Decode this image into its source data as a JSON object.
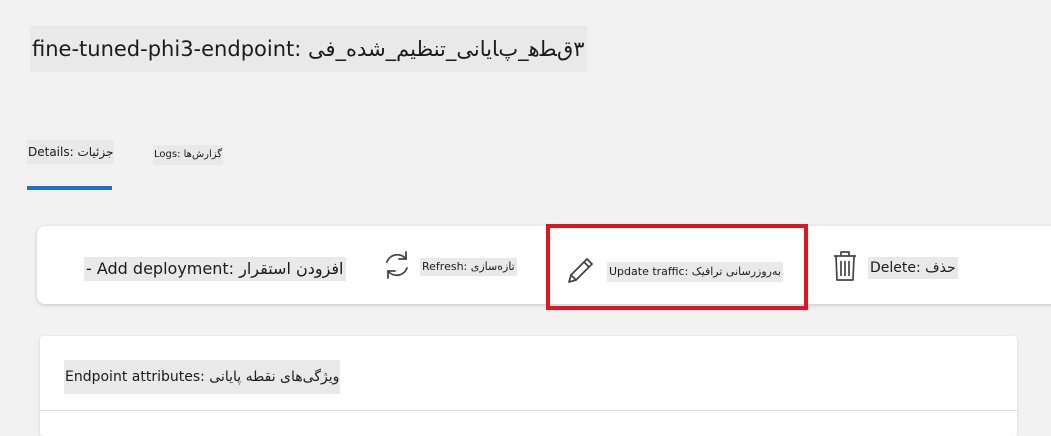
{
  "page": {
    "title": "fine-tuned-phi3-endpoint: ٣ﻕﻄﻫ_ﭖﺎﯾﺎﻧﯽ_ﺗﻨﻈﯿﻢ_ﺷﺪﻩ_ﻓﯽ"
  },
  "tabs": [
    {
      "label": "Details: ﺟﺰﺋﯿﺎﺕ",
      "active": true
    },
    {
      "label": "Logs: ﮔﺰﺍﺭﺵﻫﺎ",
      "active": false
    }
  ],
  "toolbar": {
    "add_label": "- Add deployment: ﺍﻓﺰﻭﺩﻥ ﺍﺳﺘﻘﺮﺍﺭ",
    "refresh_label": "Refresh: ﺗﺎﺯﻩﺳﺎﺯﯼ",
    "update_label": "Update traffic: ﺑﻪﺭﻭﺯﺭﺳﺎﻧﯽ ﺗﺮﺍﻓﯿﮏ",
    "delete_label": "Delete: ﺣﺬﻑ"
  },
  "card": {
    "header": "Endpoint attributes: ﻭﯾﮋﮔﯽﻫﺎﯼ ﻧﻘﻄﻪ ﭘﺎﯾﺎﻧﯽ"
  },
  "icons": {
    "refresh": "refresh-icon",
    "edit": "pencil-icon",
    "delete": "trash-icon"
  },
  "colors": {
    "accent": "#1f6fd0",
    "highlight": "#e3131f"
  }
}
